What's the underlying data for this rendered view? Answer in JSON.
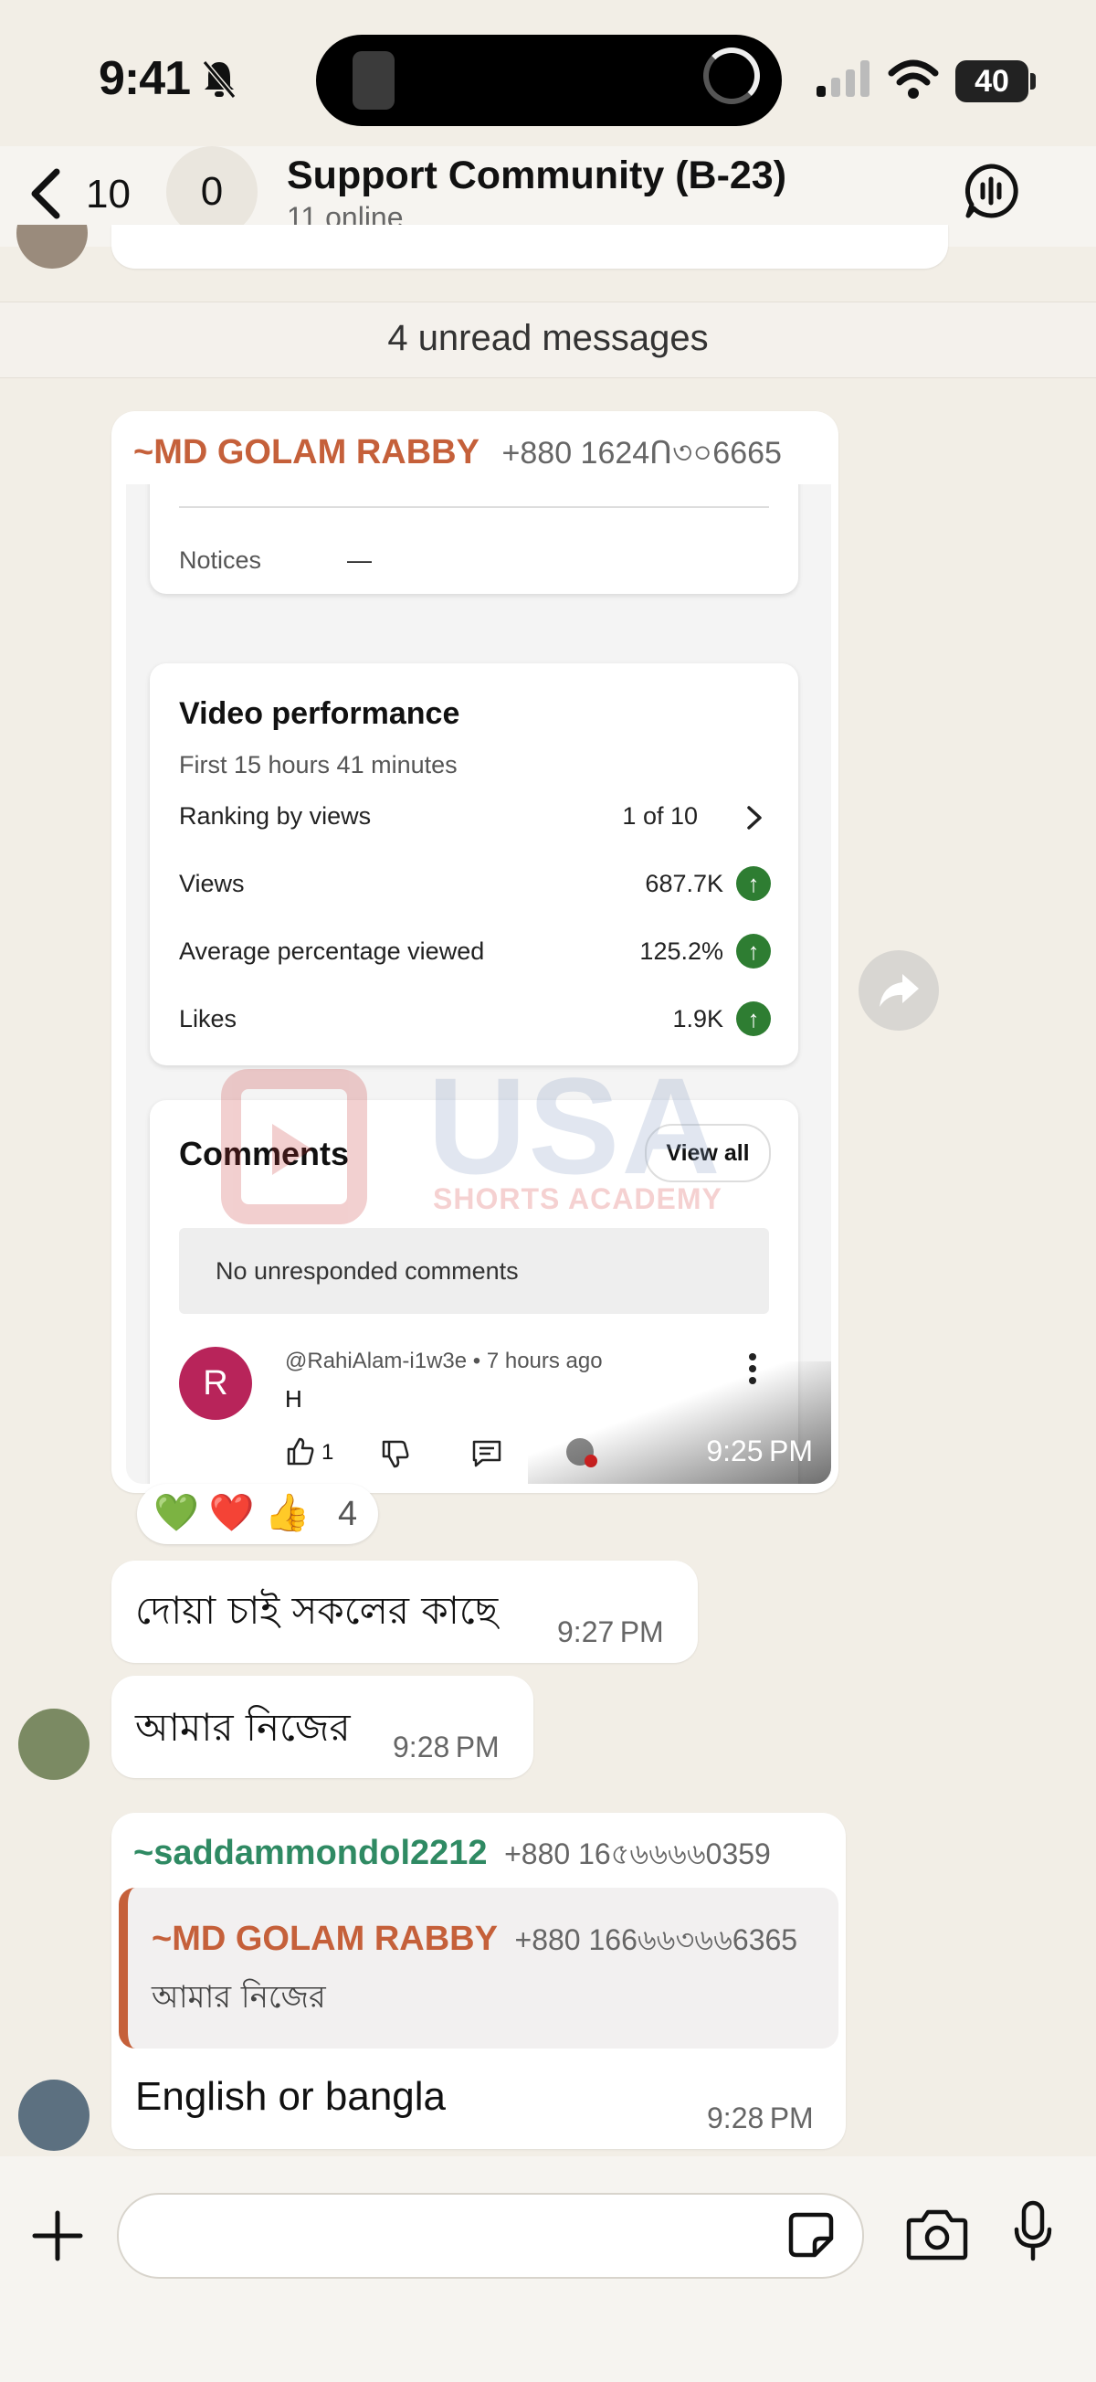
{
  "status_bar": {
    "time": "9:41",
    "battery": "40"
  },
  "header": {
    "back_count": "10",
    "avatar_text": "0؜",
    "title": "Support Community (B-23)",
    "subtitle": "11 online"
  },
  "unread": {
    "text": "4 unread messages"
  },
  "message1": {
    "sender": "~MD GOLAM RABBY",
    "phone": "+880 1624Ո৩০6665",
    "notices_label": "Notices",
    "notices_value": "—",
    "video_performance": {
      "title": "Video performance",
      "subtitle": "First 15 hours 41 minutes",
      "rows": [
        {
          "label": "Ranking by views",
          "value": "1 of 10"
        },
        {
          "label": "Views",
          "value": "687.7K"
        },
        {
          "label": "Average percentage viewed",
          "value": "125.2%"
        },
        {
          "label": "Likes",
          "value": "1.9K"
        }
      ]
    },
    "comments": {
      "title": "Comments",
      "view_all": "View all",
      "empty": "No unresponded comments",
      "comment_avatar": "R",
      "comment_author": "@RahiAlam-i1w3e • 7 hours ago",
      "comment_text": "H",
      "like_count": "1"
    },
    "watermark_main": "USA",
    "watermark_sub": "SHORTS ACADEMY",
    "time": "9:25 PM",
    "reactions": {
      "emojis": "💚 ❤️ 👍",
      "count": "4"
    }
  },
  "message2": {
    "text": "দোয়া চাই সকলের কাছে",
    "time": "9:27 PM"
  },
  "message3": {
    "text": "আমার নিজের",
    "time": "9:28 PM"
  },
  "message4": {
    "sender": "~saddammondol2212",
    "phone": "+880 16৫৬৬৬৬0359",
    "quote_sender": "~MD GOLAM RABBY",
    "quote_phone": "+880 166৬৬৩৬৬6365",
    "quote_text": "আমার নিজের",
    "text": "English or bangla",
    "time": "9:28 PM"
  },
  "colors": {
    "orange_sender": "#c5603a",
    "green_sender": "#2f8a63",
    "up_arrow": "#2e7d32",
    "background": "#f2eee6"
  },
  "icons": [
    "chevron-left-icon",
    "signal-icon",
    "wifi-icon",
    "voice-chat-icon",
    "forward-icon",
    "plus-icon",
    "sticker-icon",
    "camera-icon",
    "microphone-icon"
  ]
}
